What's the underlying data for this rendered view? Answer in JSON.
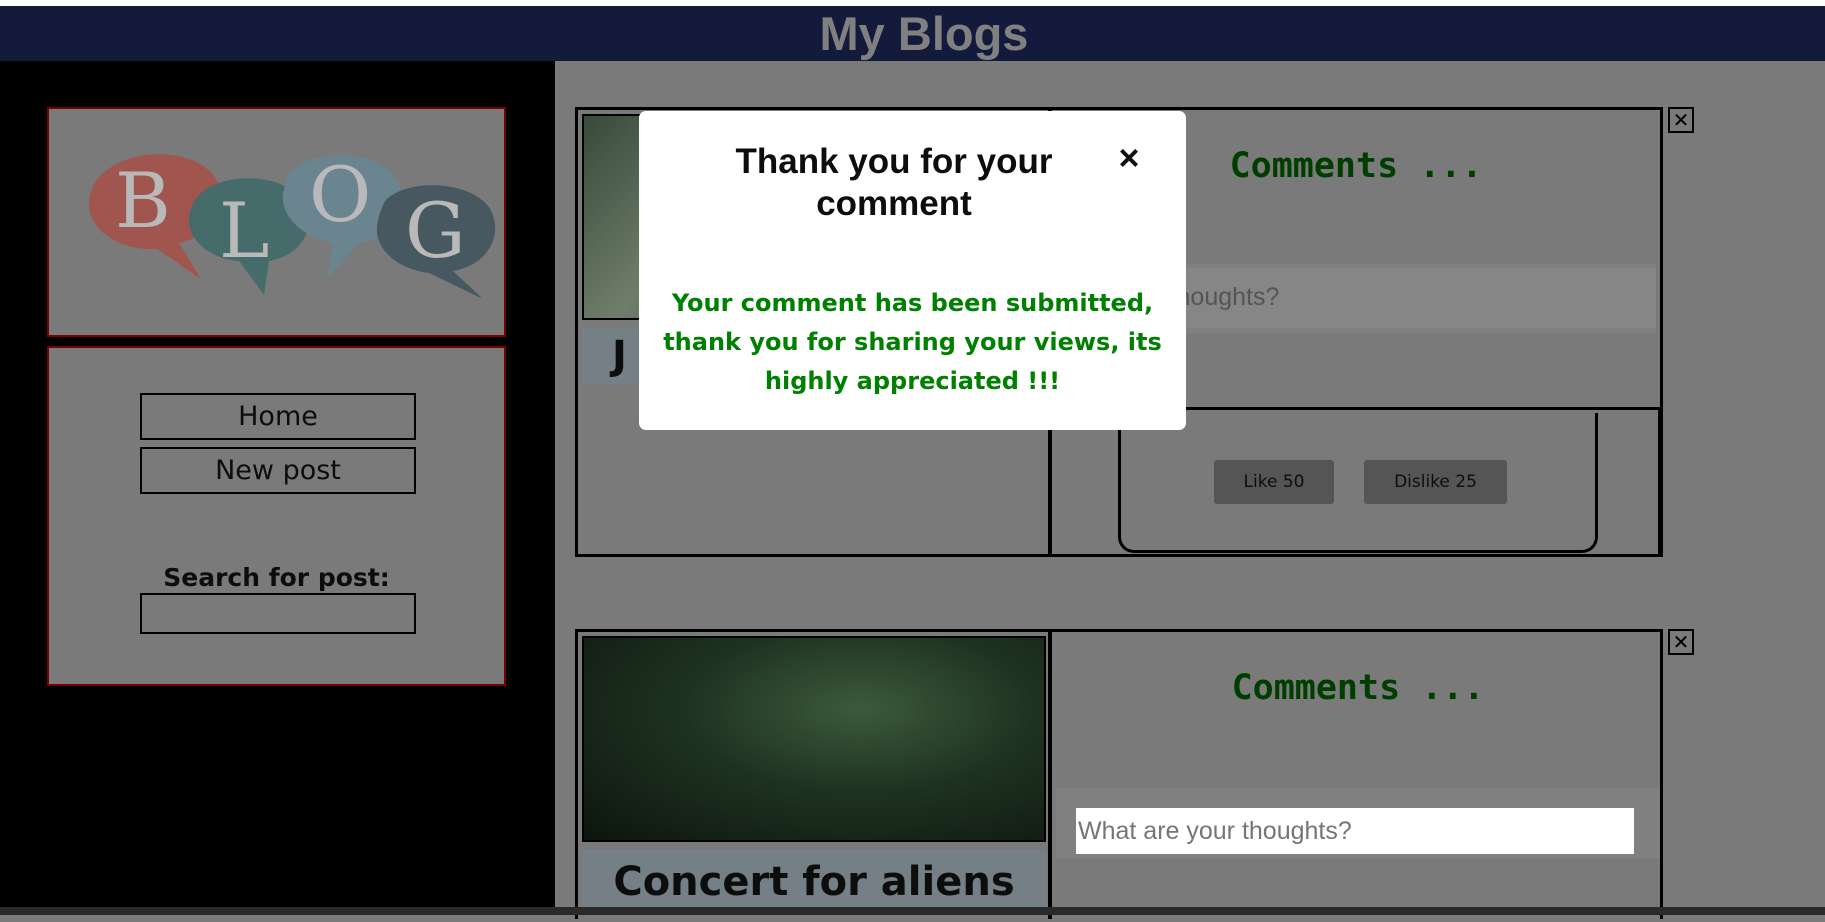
{
  "header": {
    "title": "My Blogs"
  },
  "sidebar": {
    "logo_letters": [
      "B",
      "L",
      "O",
      "G"
    ],
    "nav": [
      {
        "label": "Home"
      },
      {
        "label": "New post"
      }
    ],
    "search": {
      "label": "Search for post:",
      "value": ""
    }
  },
  "posts": [
    {
      "title": "J",
      "comments_heading": "Comments ...",
      "comment_placeholder": "What are your thoughts?",
      "comment_visible_text": "your thoughts?",
      "like_label": "Like 50",
      "dislike_label": "Dislike 25",
      "close_label": "✕"
    },
    {
      "title": "Concert for aliens",
      "comments_heading": "Comments ...",
      "comment_placeholder": "What are your thoughts?",
      "close_label": "✕"
    }
  ],
  "modal": {
    "title": "Thank you for your comment",
    "close_label": "×",
    "message": "Your comment has been submitted, thank you for sharing your views, its highly appreciated !!!"
  },
  "colors": {
    "header_bg": "#141a3c",
    "accent_green": "#008000",
    "comments_heading": "#003e00"
  }
}
